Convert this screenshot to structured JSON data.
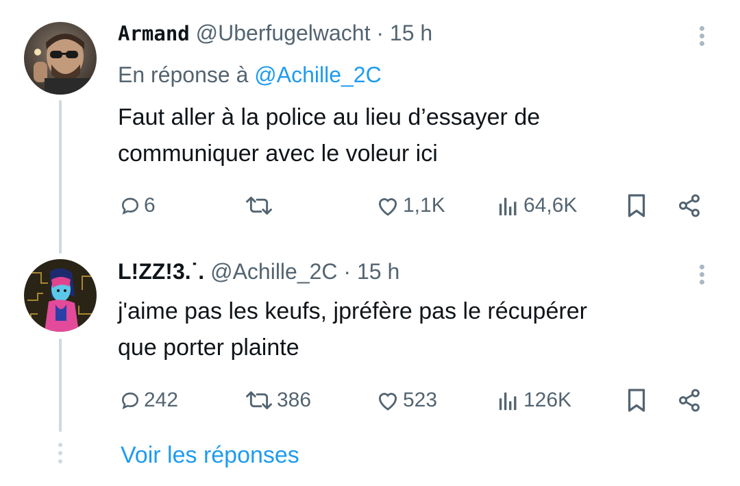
{
  "tweets": [
    {
      "display_name": "Armand",
      "handle": "@Uberfugelwacht",
      "separator": "·",
      "time": "15 h",
      "reply_prefix": "En réponse à",
      "reply_to": "@Achille_2C",
      "text_line1": "Faut aller à la police au lieu d’essayer de",
      "text_line2": "communiquer avec le voleur ici",
      "replies": "6",
      "retweets": "",
      "likes": "1,1K",
      "views": "64,6K",
      "avatar_icon": "man-with-sunglasses-smoking-avatar"
    },
    {
      "display_name": "L!ZZ!3.˙.",
      "handle": "@Achille_2C",
      "separator": "·",
      "time": "15 h",
      "text_line1": "j'aime pas les keufs, jpréfère pas le récupérer",
      "text_line2": "que porter plainte",
      "replies": "242",
      "retweets": "386",
      "likes": "523",
      "views": "126K",
      "avatar_icon": "neon-cyberpunk-girl-avatar"
    }
  ],
  "show_replies_label": "Voir les réponses",
  "colors": {
    "accent": "#1d9bf0",
    "secondary_text": "#536471",
    "thread_line": "#cfd9de"
  }
}
